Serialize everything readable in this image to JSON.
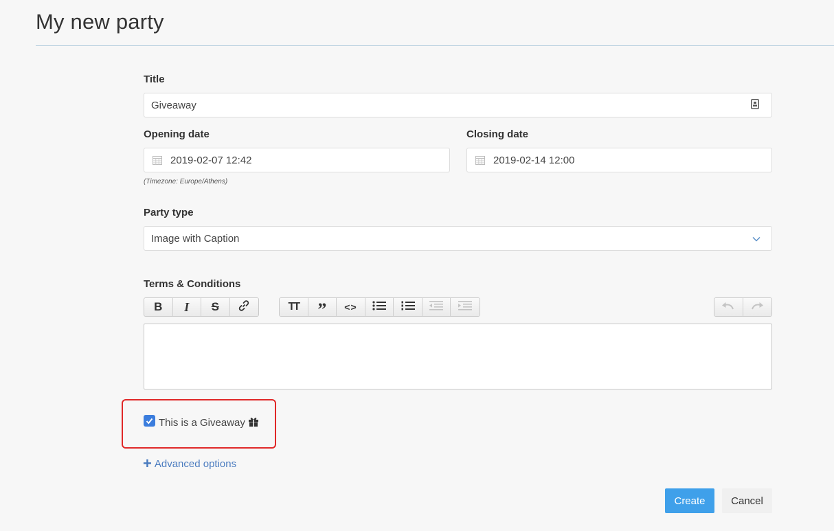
{
  "header": {
    "title": "My new party"
  },
  "form": {
    "title": {
      "label": "Title",
      "value": "Giveaway",
      "icon": "id-card-icon"
    },
    "opening": {
      "label": "Opening date",
      "value": "2019-02-07 12:42",
      "icon": "calendar-icon"
    },
    "closing": {
      "label": "Closing date",
      "value": "2019-02-14 12:00",
      "icon": "calendar-icon"
    },
    "timezone_note": "(Timezone: Europe/Athens)",
    "party_type": {
      "label": "Party type",
      "value": "Image with Caption"
    },
    "terms": {
      "label": "Terms & Conditions"
    },
    "toolbar": {
      "bold": "B",
      "italic": "I",
      "strike": "S",
      "heading": "TT",
      "quote": "”",
      "code": "<>"
    },
    "giveaway": {
      "label": "This is a Giveaway",
      "checked": true,
      "icon": "gift-icon"
    },
    "advanced": {
      "label": "Advanced options"
    }
  },
  "actions": {
    "create": "Create",
    "cancel": "Cancel"
  },
  "colors": {
    "primary": "#3fa0ea",
    "link": "#4a7bbf",
    "checkbox": "#3b7ddd",
    "highlight": "#e02828"
  }
}
